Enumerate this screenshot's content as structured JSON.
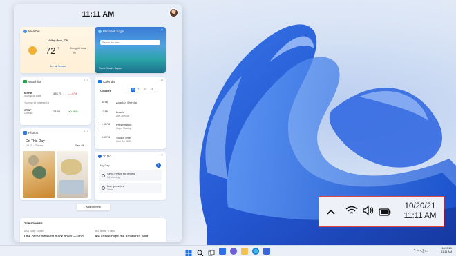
{
  "board": {
    "time": "11:11 AM"
  },
  "weather": {
    "title": "Weather",
    "location": "Valley Park, CA",
    "temperature": "72",
    "unit": "°F",
    "condition": "Strong UV today",
    "precip": "0%",
    "link": "See full forecast"
  },
  "edge": {
    "title": "Microsoft Edge",
    "search_placeholder": "Search the web",
    "location": "Rome Okachi, Japan"
  },
  "watchlist": {
    "title": "Watchlist",
    "rows": [
      {
        "symbol": "MSRB",
        "name": "Sharing-on Bank",
        "price": "435.75",
        "change": "-1.47%"
      },
      {
        "symbol": "CTSP",
        "name": "Contoso",
        "price": "23.98",
        "change": "+0.48%"
      }
    ],
    "note": "You may be interested in"
  },
  "calendar": {
    "title": "Calendar",
    "month": "October",
    "days": [
      "20",
      "21",
      "22",
      "23"
    ],
    "events": [
      {
        "time": "All day",
        "title": "Angela's Birthday",
        "sub": ""
      },
      {
        "time": "12 PM",
        "title": "Lunch",
        "sub": "Abt. Johnson"
      },
      {
        "time": "1:30 PM",
        "title": "Presentation",
        "sub": "Skype Meeting"
      },
      {
        "time": "6:00 PM",
        "title": "Studio Time",
        "sub": "Conf Rm 32/35"
      }
    ]
  },
  "photos": {
    "title": "Photos",
    "heading": "On This Day",
    "date": "Oct 20 · 33 items",
    "see_all": "See all"
  },
  "todo": {
    "title": "To Do",
    "list": "My Day",
    "tasks": [
      {
        "title": "Send invites for review",
        "sub": "Q4 planning"
      },
      {
        "title": "Buy groceries",
        "sub": "Tasks"
      }
    ]
  },
  "add_widgets": "Add widgets",
  "stories": {
    "title": "TOP STORIES",
    "items": [
      {
        "source": "USA Today · 3 mins",
        "headline": "One of the smallest black holes — and"
      },
      {
        "source": "NBC News · 5 mins",
        "headline": "Are coffee naps the answer to your"
      }
    ]
  },
  "tray_mini": {
    "date": "10/20/21",
    "time": "11:11 AM"
  },
  "callout": {
    "date": "10/20/21",
    "time": "11:11 AM"
  },
  "colors": {
    "accent": "#1a73e8",
    "callout_border": "#e0463c",
    "negative": "#d13438",
    "positive": "#107c10"
  }
}
